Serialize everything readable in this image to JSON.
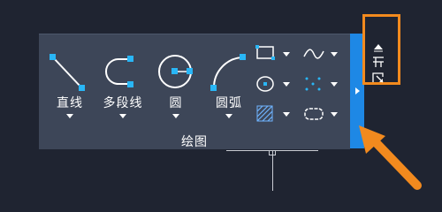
{
  "draw_panel": {
    "title": "绘图",
    "tools": [
      {
        "label": "直线",
        "icon": "line-icon"
      },
      {
        "label": "多段线",
        "icon": "polyline-icon"
      },
      {
        "label": "圆",
        "icon": "circle-icon"
      },
      {
        "label": "圆弧",
        "icon": "arc-icon"
      }
    ],
    "small_tools": [
      {
        "icon": "rectangle-icon"
      },
      {
        "icon": "spline-icon"
      },
      {
        "icon": "ellipse-icon"
      },
      {
        "icon": "point-icon"
      },
      {
        "icon": "hatch-icon"
      },
      {
        "icon": "revision-cloud-icon"
      }
    ],
    "expander_icon": "expand-panel-arrow-icon"
  },
  "side_controls": {
    "icons": [
      "minimize-panel-icon",
      "panel-layout-icon",
      "dialog-launcher-icon"
    ]
  },
  "colors": {
    "background": "#1f2431",
    "panel": "#3d4658",
    "accent_blue": "#1e88e5",
    "grip_blue": "#29b6f6",
    "highlight_orange": "#f28a1e"
  },
  "annotation_icon": "pointer-arrow-icon"
}
